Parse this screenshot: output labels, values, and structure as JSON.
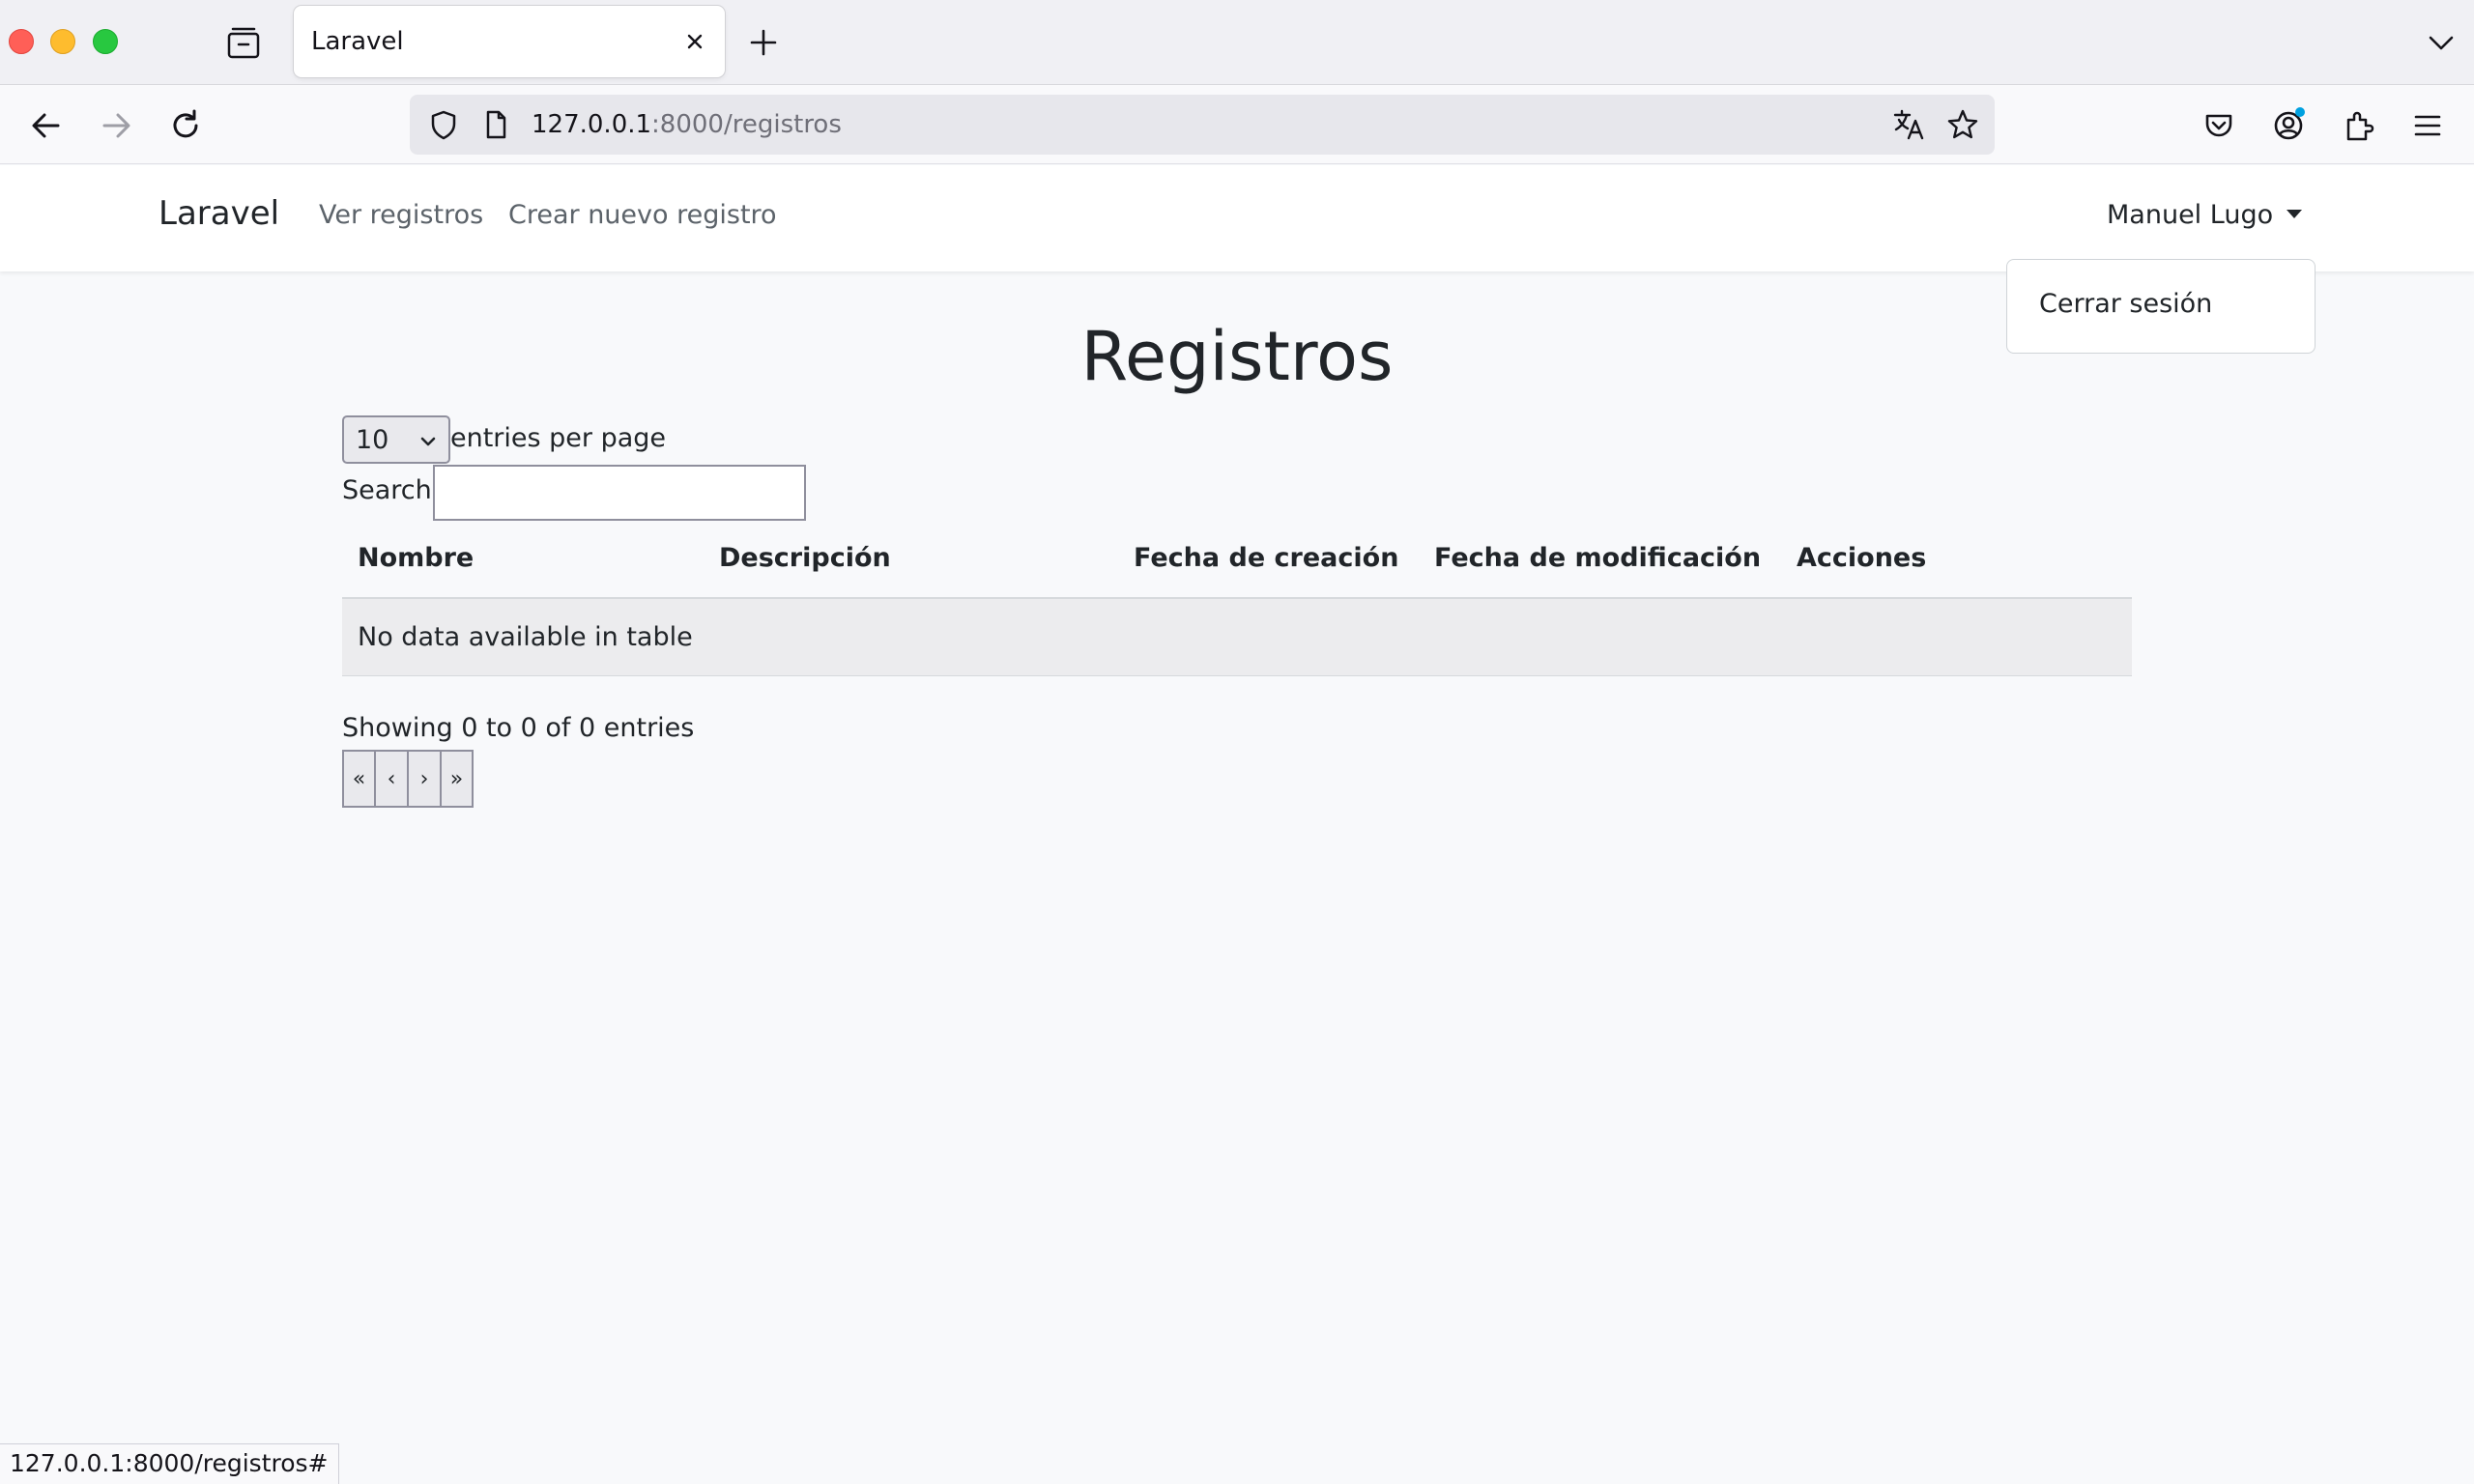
{
  "browser": {
    "tab_title": "Laravel",
    "url_host": "127.0.0.1",
    "url_rest": ":8000/registros",
    "status_url": "127.0.0.1:8000/registros#"
  },
  "app_nav": {
    "brand": "Laravel",
    "links": [
      "Ver registros",
      "Crear nuevo registro"
    ],
    "user": "Manuel Lugo",
    "dropdown_item": "Cerrar sesión"
  },
  "main": {
    "title": "Registros",
    "length": {
      "selected": "10",
      "label": "entries per page"
    },
    "search": {
      "label": "Search:",
      "value": ""
    },
    "table": {
      "columns": [
        "Nombre",
        "Descripción",
        "Fecha de creación",
        "Fecha de modificación",
        "Acciones"
      ],
      "empty_text": "No data available in table"
    },
    "info": "Showing 0 to 0 of 0 entries",
    "pager": [
      "«",
      "‹",
      "›",
      "»"
    ]
  }
}
